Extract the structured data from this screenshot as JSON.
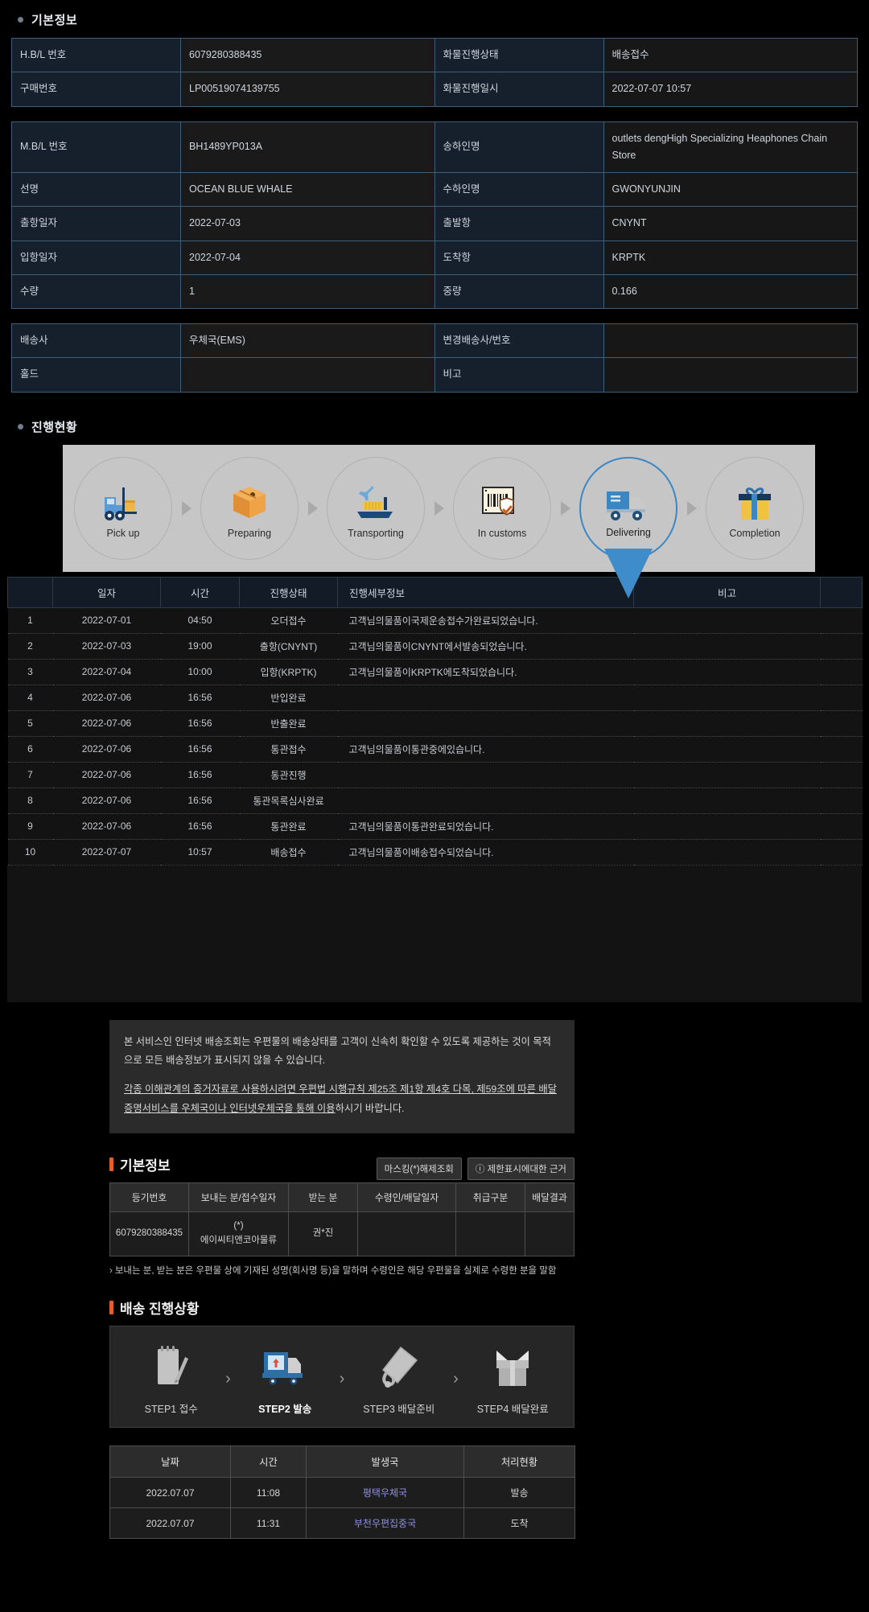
{
  "sections": {
    "basic_info_title": "기본정보",
    "progress_title": "진행현황",
    "po_basic_title": "기본정보",
    "po_progress_title": "배송 진행상황"
  },
  "basic_info": {
    "rows1": [
      {
        "label": "H.B/L 번호",
        "value": "6079280388435",
        "label2": "화물진행상태",
        "value2": "배송접수"
      },
      {
        "label": "구매번호",
        "value": "LP00519074139755",
        "label2": "화물진행일시",
        "value2": "2022-07-07 10:57"
      }
    ],
    "rows2": [
      {
        "label": "M.B/L 번호",
        "value": "BH1489YP013A",
        "label2": "송하인명",
        "value2": "outlets dengHigh Specializing Heaphones Chain Store"
      },
      {
        "label": "선명",
        "value": "OCEAN BLUE WHALE",
        "label2": "수하인명",
        "value2": "GWONYUNJIN"
      },
      {
        "label": "출항일자",
        "value": "2022-07-03",
        "label2": "출발항",
        "value2": "CNYNT"
      },
      {
        "label": "입항일자",
        "value": "2022-07-04",
        "label2": "도착항",
        "value2": "KRPTK"
      },
      {
        "label": "수량",
        "value": "1",
        "label2": "중량",
        "value2": "0.166"
      }
    ],
    "rows3": [
      {
        "label": "배송사",
        "value": "우체국(EMS)",
        "label2": "변경배송사/번호",
        "value2": ""
      },
      {
        "label": "홀드",
        "value": "",
        "label2": "비고",
        "value2": ""
      }
    ]
  },
  "progress_steps": [
    {
      "label": "Pick up",
      "icon": "forklift-icon",
      "active": false
    },
    {
      "label": "Preparing",
      "icon": "package-box-icon",
      "active": false
    },
    {
      "label": "Transporting",
      "icon": "ship-plane-icon",
      "active": false
    },
    {
      "label": "In customs",
      "icon": "barcode-shield-icon",
      "active": false
    },
    {
      "label": "Delivering",
      "icon": "truck-icon",
      "active": true
    },
    {
      "label": "Completion",
      "icon": "gift-icon",
      "active": false
    }
  ],
  "tracking_table": {
    "headers": [
      "",
      "일자",
      "시간",
      "진행상태",
      "진행세부정보",
      "비고",
      ""
    ],
    "rows": [
      {
        "no": "1",
        "date": "2022-07-01",
        "time": "04:50",
        "state": "오더접수",
        "detail": "고객님의물품이국제운송접수가완료되었습니다.",
        "note": ""
      },
      {
        "no": "2",
        "date": "2022-07-03",
        "time": "19:00",
        "state": "출항(CNYNT)",
        "detail": "고객님의물품이CNYNT에서발송되었습니다.",
        "note": ""
      },
      {
        "no": "3",
        "date": "2022-07-04",
        "time": "10:00",
        "state": "입항(KRPTK)",
        "detail": "고객님의물품이KRPTK에도착되었습니다.",
        "note": ""
      },
      {
        "no": "4",
        "date": "2022-07-06",
        "time": "16:56",
        "state": "반입완료",
        "detail": "",
        "note": ""
      },
      {
        "no": "5",
        "date": "2022-07-06",
        "time": "16:56",
        "state": "반출완료",
        "detail": "",
        "note": ""
      },
      {
        "no": "6",
        "date": "2022-07-06",
        "time": "16:56",
        "state": "통관접수",
        "detail": "고객님의물품이통관중에있습니다.",
        "note": ""
      },
      {
        "no": "7",
        "date": "2022-07-06",
        "time": "16:56",
        "state": "통관진행",
        "detail": "",
        "note": ""
      },
      {
        "no": "8",
        "date": "2022-07-06",
        "time": "16:56",
        "state": "통관목록심사완료",
        "detail": "",
        "note": ""
      },
      {
        "no": "9",
        "date": "2022-07-06",
        "time": "16:56",
        "state": "통관완료",
        "detail": "고객님의물품이통관완료되었습니다.",
        "note": ""
      },
      {
        "no": "10",
        "date": "2022-07-07",
        "time": "10:57",
        "state": "배송접수",
        "detail": "고객님의물품이배송접수되었습니다.",
        "note": ""
      }
    ]
  },
  "notice": {
    "p1": "본 서비스인 인터넷 배송조회는 우편물의 배송상태를 고객이 신속히 확인할 수 있도록 제공하는 것이 목적으로 모든 배송정보가 표시되지 않을 수 있습니다.",
    "p2_a": "각종 이해관계의 증거자료로 사용하시려면 우편법 시행규칙 제25조 제1항 제4호 다목, 제59조에 따른 배달증명서비스를 우체국이나 인터넷우체국을 통해 이용",
    "p2_b": "하시기 바랍니다."
  },
  "po_buttons": {
    "unmask": "마스킹(*)해제조회",
    "limit_basis": "제한표시에대한 근거",
    "info_icon": "ⓘ"
  },
  "po_table": {
    "headers": [
      "등기번호",
      "보내는 분/접수일자",
      "받는 분",
      "수령인/배달일자",
      "취급구분",
      "배달결과"
    ],
    "row": {
      "reg_no": "6079280388435",
      "sender_line1": "(*)",
      "sender_line2": "에이씨티앤코아물류",
      "receiver": "권*진",
      "recipient_date": "",
      "handling": "",
      "result": ""
    },
    "footnote": "보내는 분, 받는 분은 우편물 상에 기재된 성명(회사명 등)을 말하며 수령인은 해당 우편물을 실제로 수령한 분을 말함"
  },
  "po_steps": [
    {
      "label": "STEP1 접수",
      "icon": "notepad-pen-icon",
      "active": false
    },
    {
      "label": "STEP2 발송",
      "icon": "delivery-truck-icon",
      "active": true
    },
    {
      "label": "STEP3 배달준비",
      "icon": "mail-bag-icon",
      "active": false
    },
    {
      "label": "STEP4 배달완료",
      "icon": "gift-box-icon",
      "active": false
    }
  ],
  "history_table": {
    "headers": [
      "날짜",
      "시간",
      "발생국",
      "처리현황"
    ],
    "rows": [
      {
        "date": "2022.07.07",
        "time": "11:08",
        "office": "평택우체국",
        "status": "발송"
      },
      {
        "date": "2022.07.07",
        "time": "11:31",
        "office": "부천우편집중국",
        "status": "도착"
      }
    ]
  },
  "colors": {
    "accent_orange": "#e0622a",
    "active_blue": "#3b87c4",
    "link_purple": "#8f8fe8",
    "table_border_blue": "#3f5e78"
  }
}
